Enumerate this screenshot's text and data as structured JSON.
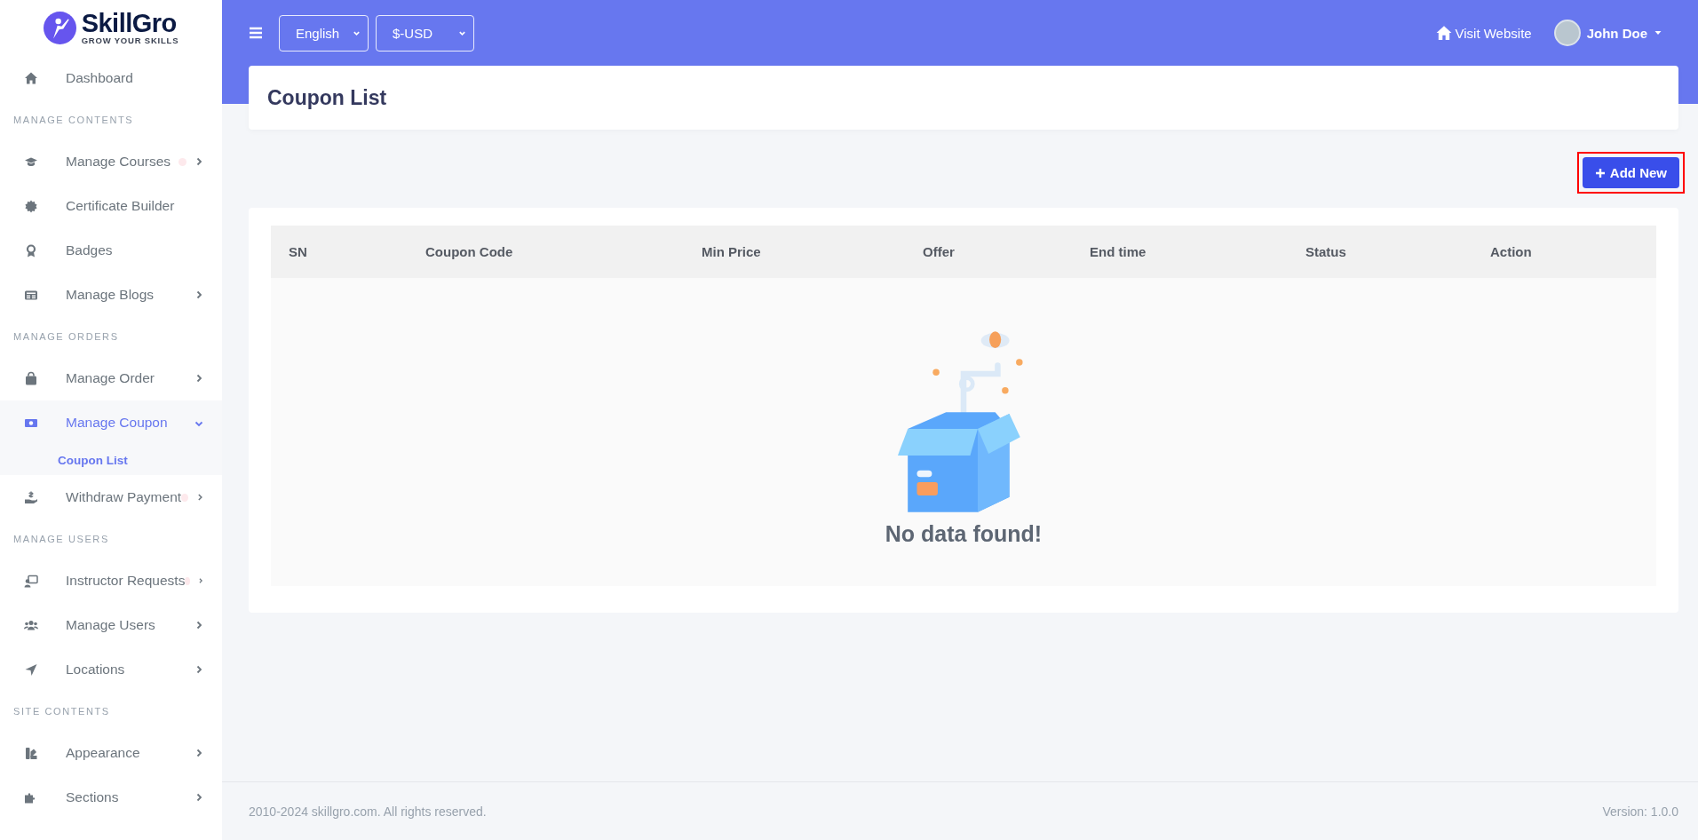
{
  "sidebar": {
    "logo": {
      "name": "SkillGro",
      "tagline": "GROW YOUR SKILLS"
    },
    "nav": [
      {
        "kind": "item",
        "label": "Dashboard",
        "expandable": false,
        "expanded": false,
        "selected": false,
        "alert": false
      },
      {
        "kind": "section",
        "label": "MANAGE CONTENTS"
      },
      {
        "kind": "item",
        "label": "Manage Courses",
        "expandable": true,
        "expanded": false,
        "selected": false,
        "alert": true
      },
      {
        "kind": "item",
        "label": "Certificate Builder",
        "expandable": false,
        "expanded": false,
        "selected": false,
        "alert": false
      },
      {
        "kind": "item",
        "label": "Badges",
        "expandable": false,
        "expanded": false,
        "selected": false,
        "alert": false
      },
      {
        "kind": "item",
        "label": "Manage Blogs",
        "expandable": true,
        "expanded": false,
        "selected": false,
        "alert": false
      },
      {
        "kind": "section",
        "label": "MANAGE ORDERS"
      },
      {
        "kind": "item",
        "label": "Manage Order",
        "expandable": true,
        "expanded": false,
        "selected": false,
        "alert": false
      },
      {
        "kind": "item",
        "label": "Manage Coupon",
        "expandable": true,
        "expanded": true,
        "selected": true,
        "alert": false
      },
      {
        "kind": "subitem",
        "label": "Coupon List",
        "selected": true
      },
      {
        "kind": "item",
        "label": "Withdraw Payment",
        "expandable": true,
        "expanded": false,
        "selected": false,
        "alert": true
      },
      {
        "kind": "section",
        "label": "MANAGE USERS"
      },
      {
        "kind": "item",
        "label": "Instructor Requests",
        "expandable": true,
        "expanded": false,
        "selected": false,
        "alert": true
      },
      {
        "kind": "item",
        "label": "Manage Users",
        "expandable": true,
        "expanded": false,
        "selected": false,
        "alert": false
      },
      {
        "kind": "item",
        "label": "Locations",
        "expandable": true,
        "expanded": false,
        "selected": false,
        "alert": false
      },
      {
        "kind": "section",
        "label": "SITE CONTENTS"
      },
      {
        "kind": "item",
        "label": "Appearance",
        "expandable": true,
        "expanded": false,
        "selected": false,
        "alert": false
      },
      {
        "kind": "item",
        "label": "Sections",
        "expandable": true,
        "expanded": false,
        "selected": false,
        "alert": false
      }
    ]
  },
  "header": {
    "language": "English",
    "currency": "$-USD",
    "visit_website": "Visit Website",
    "user": "John Doe"
  },
  "page": {
    "title": "Coupon List",
    "add_button": {
      "label": "Add New",
      "highlighted": true
    },
    "table": {
      "columns": [
        "SN",
        "Coupon Code",
        "Min Price",
        "Offer",
        "End time",
        "Status",
        "Action"
      ],
      "empty_message": "No data found!"
    }
  },
  "footer": {
    "copyright": "2010-2024 skillgro.com. All rights reserved.",
    "version": "Version: 1.0.0"
  }
}
